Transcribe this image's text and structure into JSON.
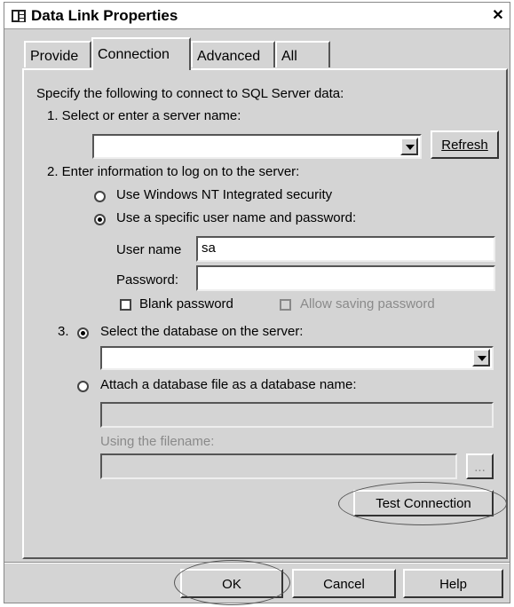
{
  "window": {
    "title": "Data Link Properties",
    "close_glyph": "✕"
  },
  "tabs": [
    {
      "label": "Provide"
    },
    {
      "label": "Connection"
    },
    {
      "label": "Advanced"
    },
    {
      "label": "All"
    }
  ],
  "connection": {
    "intro": "Specify the following to connect to SQL Server data:",
    "step1_label": "1. Select or enter a server name:",
    "server_value": "",
    "refresh_label": "Refresh",
    "step2_label": "2. Enter information to log on to the server:",
    "nt_security_label": "Use Windows NT Integrated security",
    "specific_user_label": "Use a specific user name and password:",
    "username_label": "User name",
    "username_value": "sa",
    "password_label": "Password:",
    "password_value": "",
    "blank_password_label": "Blank password",
    "allow_saving_label": "Allow saving password",
    "step3_prefix": "3.",
    "select_db_label": "Select the database on the server:",
    "database_value": "",
    "attach_db_label": "Attach a database file as a database name:",
    "attach_name_value": "",
    "using_filename_label": "Using the filename:",
    "filename_value": "",
    "browse_label": "...",
    "test_connection_label": "Test Connection"
  },
  "footer": {
    "ok_label": "OK",
    "cancel_label": "Cancel",
    "help_label": "Help"
  }
}
